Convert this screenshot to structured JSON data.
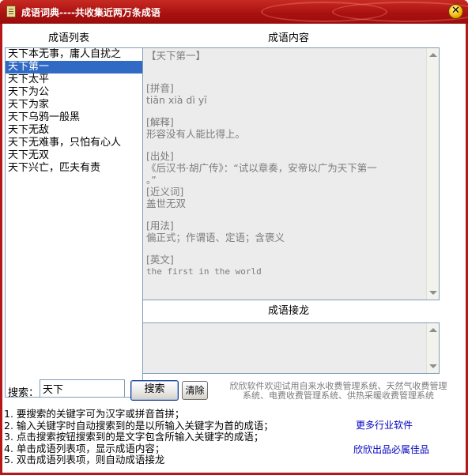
{
  "window": {
    "title": "成语词典----共收集近两万条成语",
    "close_glyph": "✕"
  },
  "labels": {
    "list": "成语列表",
    "content": "成语内容",
    "chain": "成语接龙",
    "search": "搜索："
  },
  "list": {
    "items": [
      "天下本无事，庸人自扰之",
      "天下第一",
      "天下太平",
      "天下为公",
      "天下为家",
      "天下乌鸦一般黑",
      "天下无敌",
      "天下无难事，只怕有心人",
      "天下无双",
      "天下兴亡，匹夫有责"
    ],
    "selected_index": 1
  },
  "content": {
    "heading": "【天下第一】",
    "pinyin_label": "[拼音]",
    "pinyin": "tiān  xià  dì  yī",
    "explain_label": "[解释]",
    "explain": "形容没有人能比得上。",
    "source_label": "[出处]",
    "source_line1": "《后汉书·胡广传》：“试以章奏，安帝以广为天下第一",
    "source_line2": "。”",
    "synonym_label": "[近义词]",
    "synonym": "盖世无双",
    "usage_label": "[用法]",
    "usage": "偏正式；作谓语、定语；含褒义",
    "english_label": "[英文]",
    "english": "the first in the world"
  },
  "search": {
    "value": "天下",
    "search_button": "搜索",
    "clear_button": "清除"
  },
  "promo": {
    "line1": "欣欣软件欢迎试用自来水收费管理系统、天然气收费管理",
    "line2": "系统、电费收费管理系统、供热采暖收费管理系统"
  },
  "instructions": [
    "1. 要搜索的关键字可为汉字或拼音首拼；",
    "2. 输入关键字时自动搜索到的是以所输入关键字为首的成语；",
    "3. 点击搜索按钮搜索到的是文字包含所输入关键字的成语；",
    "4. 单击成语列表项，显示成语内容；",
    "5. 双击成语列表项，则自动成语接龙"
  ],
  "links": {
    "more_software": "更多行业软件",
    "slogan": "欣欣出品必属佳品"
  },
  "colors": {
    "title_bar": "#a81010",
    "selection": "#316ac5",
    "link": "#0000c0"
  }
}
